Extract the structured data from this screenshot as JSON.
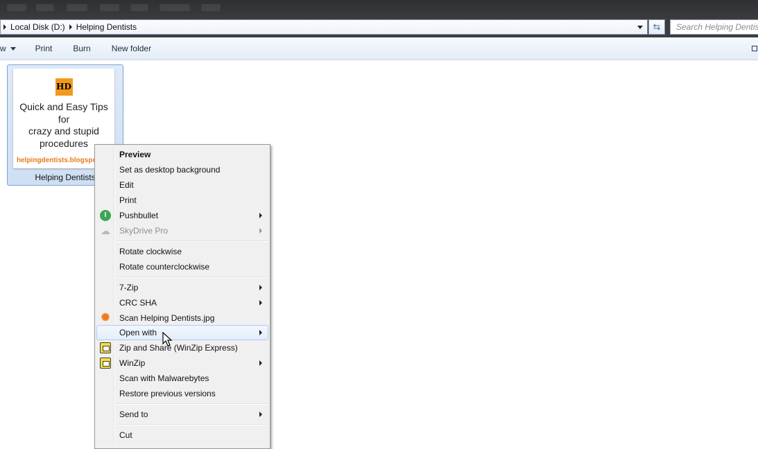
{
  "address": {
    "segments": [
      "Local Disk (D:)",
      "Helping Dentists"
    ],
    "search_placeholder": "Search Helping Dentists"
  },
  "toolbar": {
    "view_fragment": "w",
    "print": "Print",
    "burn": "Burn",
    "new_folder": "New folder"
  },
  "file": {
    "name": "Helping Dentists",
    "thumbnail": {
      "logo_text": "HD",
      "lines": [
        "Quick and Easy Tips",
        "for",
        "crazy and stupid",
        "procedures"
      ],
      "url": "helpingdentists.blogspot.com"
    }
  },
  "context_menu": {
    "items": [
      {
        "label": "Preview",
        "bold": true
      },
      {
        "label": "Set as desktop background"
      },
      {
        "label": "Edit"
      },
      {
        "label": "Print"
      },
      {
        "label": "Pushbullet",
        "icon": "pushbullet-icon",
        "submenu": true
      },
      {
        "label": "SkyDrive Pro",
        "icon": "skydrive-icon",
        "submenu": true,
        "disabled": true
      },
      {
        "label": "Rotate clockwise"
      },
      {
        "label": "Rotate counterclockwise"
      },
      {
        "label": "7-Zip",
        "submenu": true
      },
      {
        "label": "CRC SHA",
        "submenu": true
      },
      {
        "label": "Scan Helping Dentists.jpg",
        "icon": "avast-icon"
      },
      {
        "label": "Open with",
        "submenu": true,
        "hovered": true
      },
      {
        "label": "Zip and Share (WinZip Express)",
        "icon": "winzip-icon"
      },
      {
        "label": "WinZip",
        "icon": "winzip-icon",
        "submenu": true
      },
      {
        "label": "Scan with Malwarebytes"
      },
      {
        "label": "Restore previous versions"
      },
      {
        "label": "Send to",
        "submenu": true
      },
      {
        "label": "Cut"
      }
    ]
  },
  "colors": {
    "accent_hover": "#aecbf1",
    "pushbullet": "#3ba656",
    "avast": "#f07b1e",
    "thumbnail_url": "#e57b1c"
  }
}
